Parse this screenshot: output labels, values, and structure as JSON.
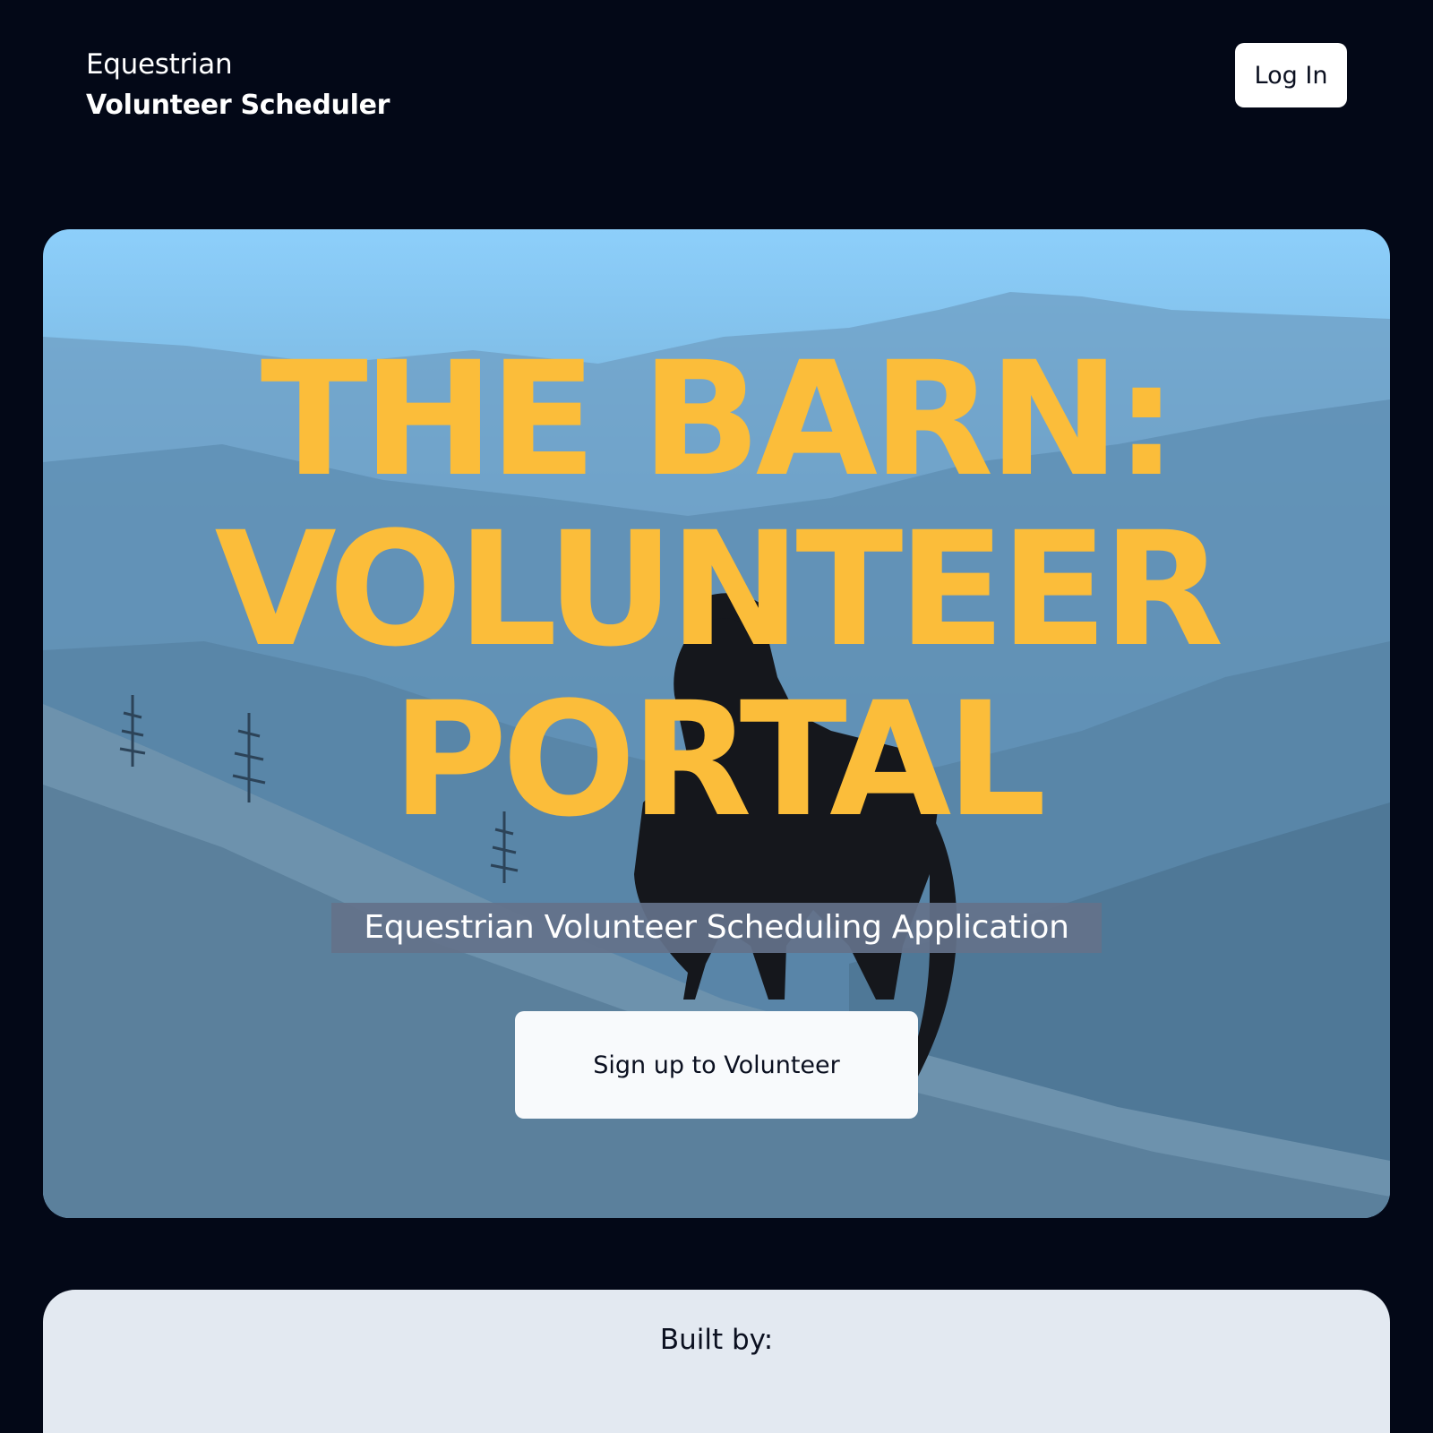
{
  "header": {
    "brand_line1": "Equestrian",
    "brand_line2": "Volunteer Scheduler",
    "login_label": "Log In"
  },
  "hero": {
    "title_lines": [
      "THE BARN:",
      "VOLUNTEER",
      "PORTAL"
    ],
    "subtitle": "Equestrian Volunteer Scheduling Application",
    "cta_label": "Sign up to Volunteer"
  },
  "footer": {
    "built_by_label": "Built by:"
  },
  "colors": {
    "background": "#030817",
    "accent_title": "#fbbd3a",
    "subtitle_band": "#64728a",
    "card_light": "#e3e9f1"
  }
}
